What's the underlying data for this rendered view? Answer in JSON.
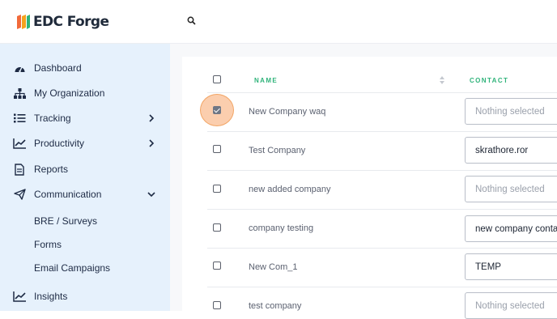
{
  "app": {
    "logo_text": "EDC Forge"
  },
  "colors": {
    "sidebar_bg": "#e6f1fc",
    "accent_green": "#2fb37a",
    "highlight": "#f7a66c"
  },
  "sidebar": {
    "items": [
      {
        "label": "Dashboard",
        "icon": "dashboard-gauge-icon"
      },
      {
        "label": "My Organization",
        "icon": "org-chart-icon"
      },
      {
        "label": "Tracking",
        "icon": "list-icon",
        "chevron": "right"
      },
      {
        "label": "Productivity",
        "icon": "line-chart-icon",
        "chevron": "right"
      },
      {
        "label": "Reports",
        "icon": "document-icon"
      },
      {
        "label": "Communication",
        "icon": "paper-plane-icon",
        "chevron": "down"
      }
    ],
    "sub_items": [
      "BRE / Surveys",
      "Forms",
      "Email Campaigns"
    ],
    "insights": {
      "label": "Insights",
      "icon": "line-chart-icon"
    }
  },
  "table": {
    "headers": {
      "name": "NAME",
      "contact": "CONTACT"
    },
    "rows": [
      {
        "name": "New Company waq",
        "contact": "Nothing selected",
        "placeholder": true,
        "checked": true
      },
      {
        "name": "Test Company",
        "contact": "skrathore.ror",
        "placeholder": false,
        "checked": false
      },
      {
        "name": "new added company",
        "contact": "Nothing selected",
        "placeholder": true,
        "checked": false
      },
      {
        "name": "company testing",
        "contact": "new company contact",
        "placeholder": false,
        "checked": false
      },
      {
        "name": "New Com_1",
        "contact": "TEMP",
        "placeholder": false,
        "checked": false
      },
      {
        "name": "test company",
        "contact": "Nothing selected",
        "placeholder": true,
        "checked": false
      }
    ]
  }
}
